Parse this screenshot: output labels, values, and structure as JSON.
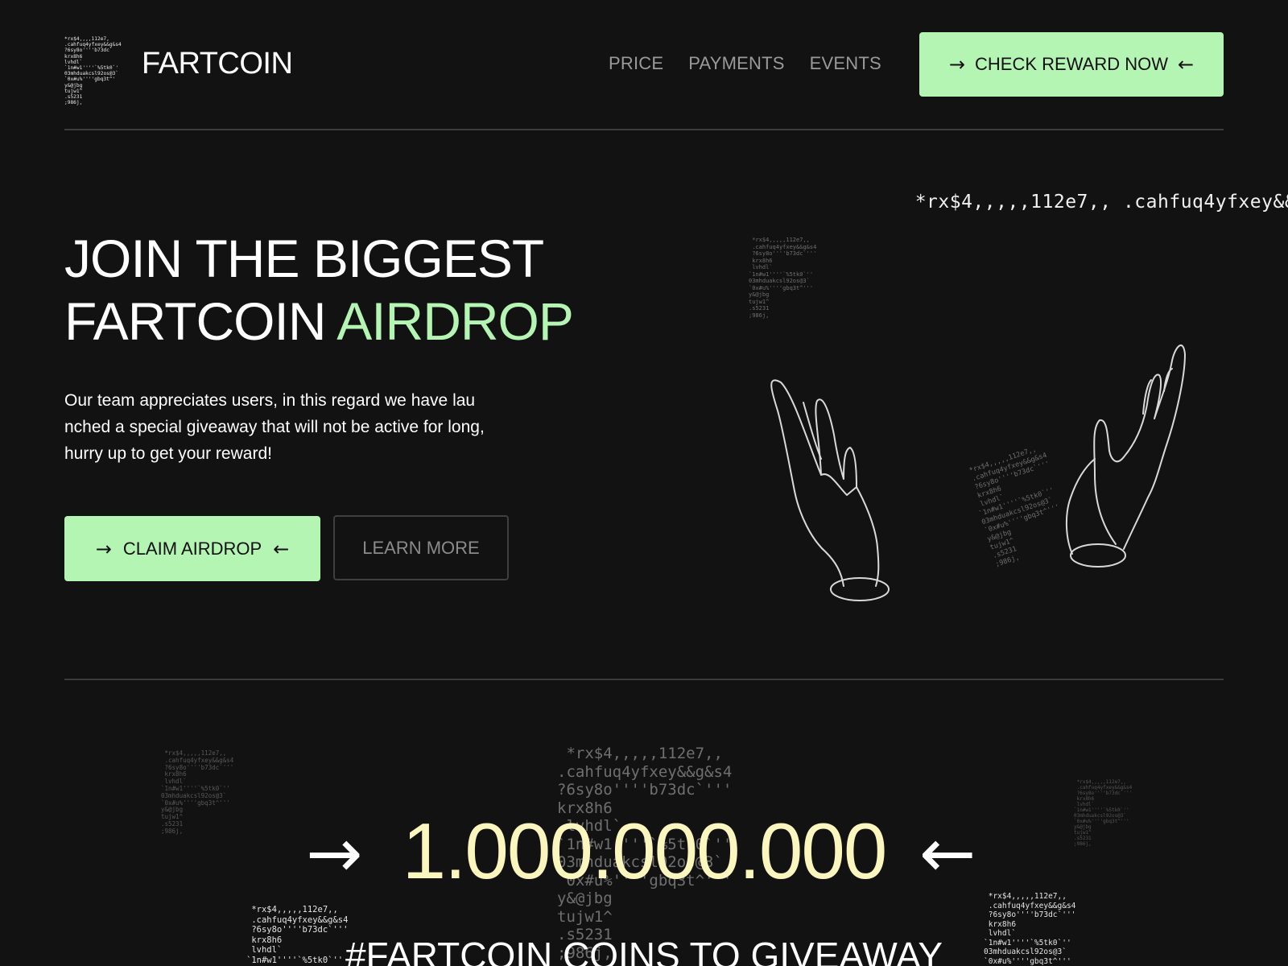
{
  "header": {
    "brand": "FARTCOIN",
    "nav": [
      "PRICE",
      "PAYMENTS",
      "EVENTS"
    ],
    "cta_label": "CHECK REWARD NOW"
  },
  "hero": {
    "title_line1": "JOIN THE BIGGEST",
    "title_line2_a": "FARTCOIN ",
    "title_line2_b": "AIRDROP",
    "paragraph_lines": [
      "Our team appreciates users, in this regard we have lau",
      "nched a special giveaway that will not be active for long,",
      "hurry up to get your reward!"
    ],
    "primary_button": "CLAIM AIRDROP",
    "secondary_button": "LEARN MORE"
  },
  "giveaway": {
    "amount": "1.000.000.000",
    "caption": "#FARTCOIN COINS TO GIVEAWAY"
  },
  "ascii_art": {
    "top": [
      "*rx$4,,,,,112e7,,"
    ],
    "top_s1": [
      ".cahfu"
    ],
    "top_s1b": [
      "q4yfxey&&g&s4"
    ],
    "top_s2": [
      "''''b73dc`'''"
    ],
    "stem": [
      "?6sy8o",
      "krx8h6",
      "lvhdl`"
    ],
    "mid1": [
      "`1n#w1",
      "''''`%5tk0`''"
    ],
    "mid2": [
      "03mhd",
      "uakcsl92os@3`"
    ],
    "mid3": [
      "`0x#u%",
      "''''gbq3t^'''"
    ],
    "tail": [
      "y&@jbg",
      "tujw1^",
      ".s5231",
      ";986j,"
    ]
  },
  "icons": {
    "arrow_right": "→",
    "arrow_left": "←",
    "hands": "hands-illustration"
  },
  "colors": {
    "background": "#121212",
    "accent_green": "#b5f5b4",
    "number_yellow": "#fbf6bd",
    "nav_gray": "#9a9a9a"
  }
}
